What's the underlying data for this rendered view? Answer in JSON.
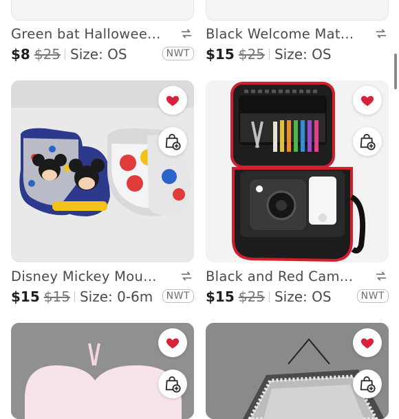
{
  "colors": {
    "accent": "#d6223b",
    "text": "#2b2b2b"
  },
  "listings": [
    {
      "title": "Green bat Hallowee...",
      "price": "$8",
      "original_price": "$25",
      "size": "Size: OS",
      "condition": "NWT"
    },
    {
      "title": "Black Welcome Mat...",
      "price": "$15",
      "original_price": "$25",
      "size": "Size: OS",
      "condition": ""
    },
    {
      "title": "Disney Mickey Mou...",
      "price": "$15",
      "original_price": "$15",
      "size": "Size: 0-6m",
      "condition": "NWT",
      "image_icon": "baby-socks-image"
    },
    {
      "title": "Black and Red Cam...",
      "price": "$15",
      "original_price": "$25",
      "size": "Size: OS",
      "condition": "NWT",
      "image_icon": "camera-case-image"
    },
    {
      "image_icon": "pink-heart-pillow-image"
    },
    {
      "image_icon": "jeweled-mirror-image"
    }
  ],
  "icons": {
    "like": "heart-icon",
    "share": "share-icon",
    "bag": "bag-plus-icon"
  }
}
